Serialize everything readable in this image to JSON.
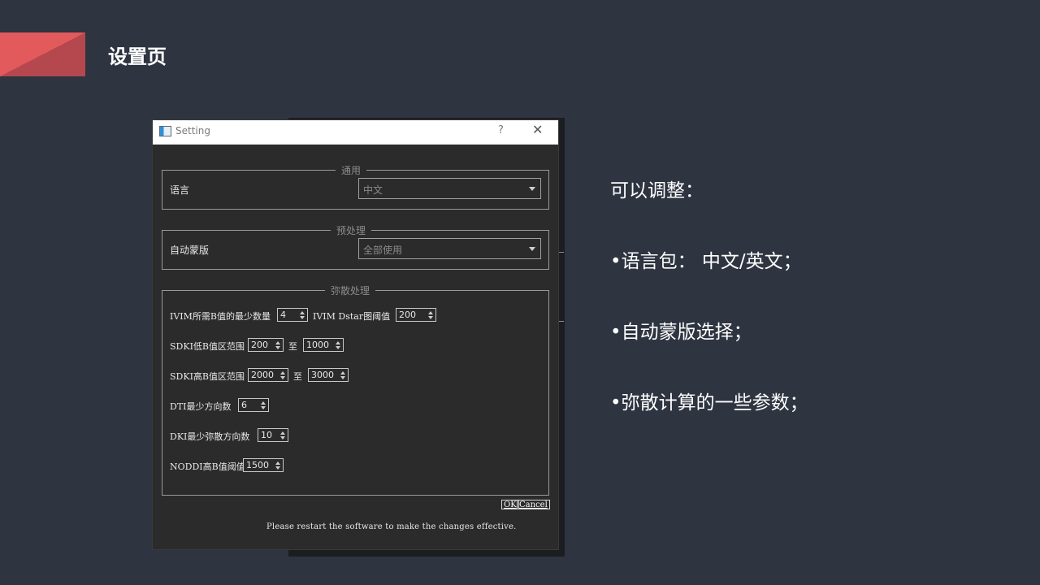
{
  "slide": {
    "title": "设置页",
    "bullets": [
      "可以调整：",
      "•语言包： 中文/英文；",
      "•自动蒙版选择；",
      "•弥散计算的一些参数；"
    ],
    "accent_color": "#e35a5c"
  },
  "dialog": {
    "title": "Setting",
    "help_label": "?",
    "close_label": "✕",
    "general": {
      "group_title": "通用",
      "language_label": "语言",
      "language_value": "中文"
    },
    "preprocess": {
      "group_title": "预处理",
      "mask_label": "自动蒙版",
      "mask_value": "全部使用"
    },
    "diffusion": {
      "group_title": "弥散处理",
      "ivim_min_b_label": "IVIM所需B值的最少数量",
      "ivim_min_b_value": "4",
      "ivim_dstar_label": "IVIM Dstar图阈值",
      "ivim_dstar_value": "200",
      "sdki_low_label": "SDKI低B值区范围",
      "sdki_low_from": "200",
      "sdki_low_to": "1000",
      "sdki_high_label": "SDKI高B值区范围",
      "sdki_high_from": "2000",
      "sdki_high_to": "3000",
      "to_label": "至",
      "dti_label": "DTI最少方向数",
      "dti_value": "6",
      "dki_label": "DKI最少弥散方向数",
      "dki_value": "10",
      "noddi_label": "NODDI高B值阈值",
      "noddi_value": "1500"
    },
    "ok_label": "OK",
    "cancel_label": "Cancel",
    "restart_note": "Please restart the software to make the changes effective."
  }
}
